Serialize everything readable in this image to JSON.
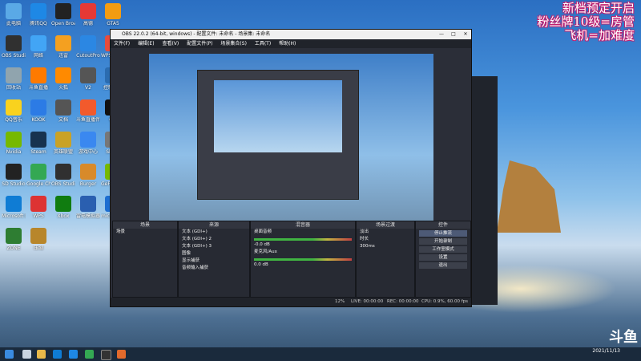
{
  "overlay_lines": [
    "新档预定开启",
    "粉丝牌10级=房管",
    "飞机=加难度"
  ],
  "desktop_icons": [
    {
      "label": "此电脑",
      "color": "#5aa9e6"
    },
    {
      "label": "腾讯QQ",
      "color": "#1e88e5"
    },
    {
      "label": "Open Broadcaster",
      "color": "#222"
    },
    {
      "label": "高德",
      "color": "#e53935"
    },
    {
      "label": "GTA5",
      "color": "#f39c12"
    },
    {
      "label": "OBS Studio",
      "color": "#303030"
    },
    {
      "label": "网络",
      "color": "#42a5f5"
    },
    {
      "label": "迅雷",
      "color": "#f4a020"
    },
    {
      "label": "CutoutPro",
      "color": "#2b87e3"
    },
    {
      "label": "WPS Office",
      "color": "#e84c3d"
    },
    {
      "label": "回收站",
      "color": "#90a4ae"
    },
    {
      "label": "斗鱼直播",
      "color": "#ff7a00"
    },
    {
      "label": "火狐",
      "color": "#ff8a00"
    },
    {
      "label": "V2",
      "color": "#555"
    },
    {
      "label": "控制面板",
      "color": "#2b6cb0"
    },
    {
      "label": "QQ音乐",
      "color": "#f9d21e"
    },
    {
      "label": "KOOK",
      "color": "#2c7be5"
    },
    {
      "label": "文档",
      "color": "#555"
    },
    {
      "label": "斗鱼直播伴侣",
      "color": "#f25a2c"
    },
    {
      "label": "QQ",
      "color": "#111"
    },
    {
      "label": "Nvidia",
      "color": "#76b900"
    },
    {
      "label": "Steam",
      "color": "#17324f"
    },
    {
      "label": "英雄联盟",
      "color": "#c9a227"
    },
    {
      "label": "游戏中心",
      "color": "#3a88f0"
    },
    {
      "label": "Sharp",
      "color": "#777"
    },
    {
      "label": "SD Studio",
      "color": "#222"
    },
    {
      "label": "Google Chrome",
      "color": "#34a853"
    },
    {
      "label": "OBS Studio",
      "color": "#303030"
    },
    {
      "label": "Burger",
      "color": "#d88a2a"
    },
    {
      "label": "GeForce Experience",
      "color": "#76b900"
    },
    {
      "label": "Microsoft Edge",
      "color": "#0f7cd4"
    },
    {
      "label": "WPS",
      "color": "#d33"
    },
    {
      "label": "Xbox",
      "color": "#107c10"
    },
    {
      "label": "雷电模拟器",
      "color": "#2a5fb0"
    },
    {
      "label": "microsoftedge",
      "color": "#1d6ed1"
    },
    {
      "label": "ZONE",
      "color": "#2e7d32"
    },
    {
      "label": "压缩",
      "color": "#b8862b"
    }
  ],
  "obs": {
    "title": "OBS 22.0.2 (64-bit, windows) - 配置文件: 未命名 - 场景集: 未命名",
    "menu": [
      "文件(F)",
      "编辑(E)",
      "查看(V)",
      "配置文件(P)",
      "场景集合(S)",
      "工具(T)",
      "帮助(H)"
    ],
    "docks": {
      "scenes": {
        "title": "场景",
        "items": [
          "场景"
        ]
      },
      "sources": {
        "title": "来源",
        "items": [
          "文本 (GDI+)",
          "文本 (GDI+) 2",
          "文本 (GDI+) 3",
          "图像",
          "显示捕获",
          "音频输入捕获"
        ]
      },
      "mixer": {
        "title": "混音器",
        "tracks": [
          {
            "name": "桌面音频",
            "db": "-0.0 dB"
          },
          {
            "name": "麦克风/Aux",
            "db": "0.0 dB"
          }
        ]
      },
      "transitions": {
        "title": "场景过渡",
        "type": "淡出",
        "duration_label": "时长",
        "duration": "300ms"
      },
      "controls": {
        "title": "控件",
        "buttons": [
          "停止推流",
          "开始录制",
          "工作室模式",
          "设置",
          "退出"
        ]
      }
    },
    "status": {
      "live": "LIVE: 00:00:00",
      "rec": "REC: 00:00:00",
      "cpu": "CPU: 0.9%, 60.00 fps",
      "dropped": "12%"
    }
  },
  "douyu_logo": "斗鱼",
  "taskbar": {
    "time": "",
    "date": "2021/11/13"
  }
}
